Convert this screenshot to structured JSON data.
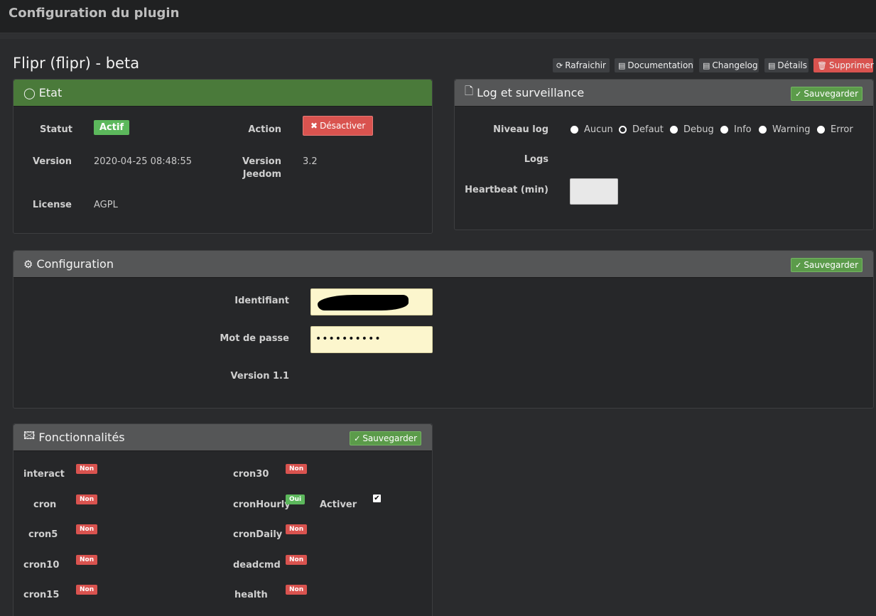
{
  "header": {
    "title": "Configuration du plugin"
  },
  "plugin": {
    "title": "Flipr (flipr) - beta"
  },
  "toolbar": {
    "refresh": "Rafraichir",
    "documentation": "Documentation",
    "changelog": "Changelog",
    "details": "Détails",
    "delete": "Supprimer"
  },
  "etat": {
    "title": "Etat",
    "statut_label": "Statut",
    "statut_value": "Actif",
    "action_label": "Action",
    "action_button": "Désactiver",
    "version_label": "Version",
    "version_value": "2020-04-25 08:48:55",
    "version_jeedom_label_1": "Version",
    "version_jeedom_label_2": "Jeedom",
    "version_jeedom_value": "3.2",
    "license_label": "License",
    "license_value": "AGPL"
  },
  "log": {
    "title": "Log et surveillance",
    "save": "Sauvegarder",
    "niveau_label": "Niveau log",
    "levels": [
      "Aucun",
      "Defaut",
      "Debug",
      "Info",
      "Warning",
      "Error"
    ],
    "selected_level": "Defaut",
    "logs_label": "Logs",
    "heartbeat_label": "Heartbeat (min)",
    "heartbeat_value": ""
  },
  "configuration": {
    "title": "Configuration",
    "save": "Sauvegarder",
    "identifiant_label": "Identifiant",
    "password_label": "Mot de passe",
    "password_value": "••••••••••",
    "version_text": "Version 1.1"
  },
  "fonctionnalites": {
    "title": "Fonctionnalités",
    "save": "Sauvegarder",
    "col1": [
      {
        "name": "interact",
        "value": "Non"
      },
      {
        "name": "cron",
        "value": "Non"
      },
      {
        "name": "cron5",
        "value": "Non"
      },
      {
        "name": "cron10",
        "value": "Non"
      },
      {
        "name": "cron15",
        "value": "Non"
      }
    ],
    "col2": [
      {
        "name": "cron30",
        "value": "Non"
      },
      {
        "name": "cronHourly",
        "value": "Oui"
      },
      {
        "name": "cronDaily",
        "value": "Non"
      },
      {
        "name": "deadcmd",
        "value": "Non"
      },
      {
        "name": "health",
        "value": "Non"
      }
    ],
    "activer_label": "Activer",
    "activer_checked": true
  },
  "colors": {
    "success": "#5cb85c",
    "danger": "#d9534f",
    "panel_green": "#4a7a3a"
  }
}
